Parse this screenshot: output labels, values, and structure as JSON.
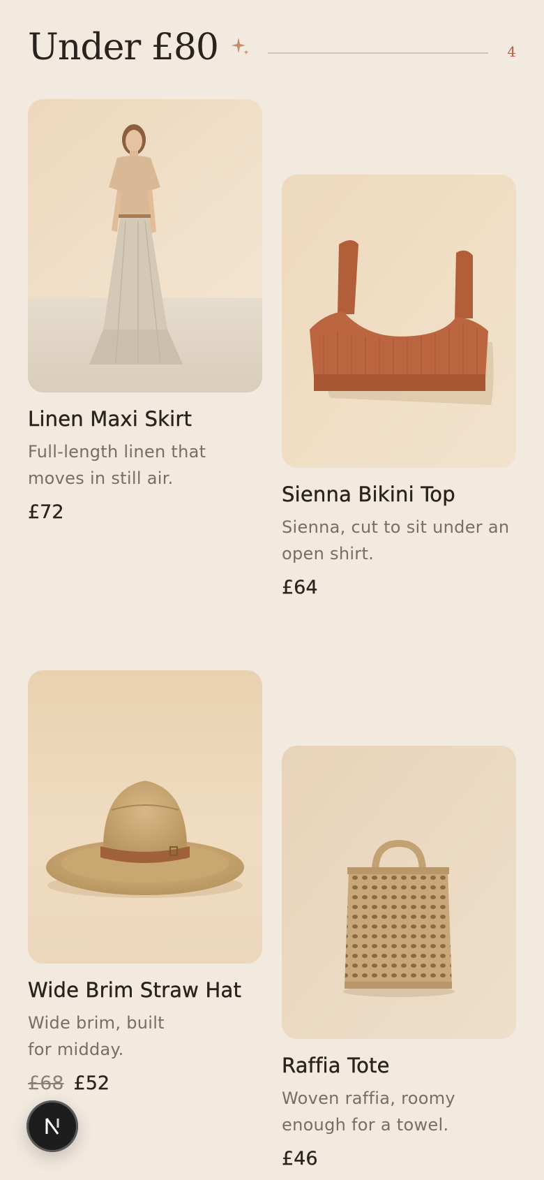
{
  "section": {
    "title": "Under £80",
    "count": "4",
    "sparkle_icon": "sparkle-icon"
  },
  "products": [
    {
      "name": "Linen Maxi Skirt",
      "description": "Full-length linen that moves in still air.",
      "price": "£72",
      "image": "woman-linen-maxi-skirt"
    },
    {
      "name": "Sienna Bikini Top",
      "description": "Sienna, cut to sit under an open shirt.",
      "price": "£64",
      "image": "rust-ribbed-bikini-top"
    },
    {
      "name": "Wide Brim Straw Hat",
      "description": "Wide brim, built for midday.",
      "original_price": "£68",
      "price": "£52",
      "image": "straw-hat-with-leather-band"
    },
    {
      "name": "Raffia Tote",
      "description": "Woven raffia, roomy enough for a towel.",
      "price": "£46",
      "image": "woven-raffia-tote"
    }
  ],
  "badge": {
    "letter": "N",
    "icon": "next-logo-icon"
  },
  "colors": {
    "background": "#f2e9df",
    "accent": "#b0604a",
    "text": "#2a231d",
    "muted": "#7a6d62"
  }
}
